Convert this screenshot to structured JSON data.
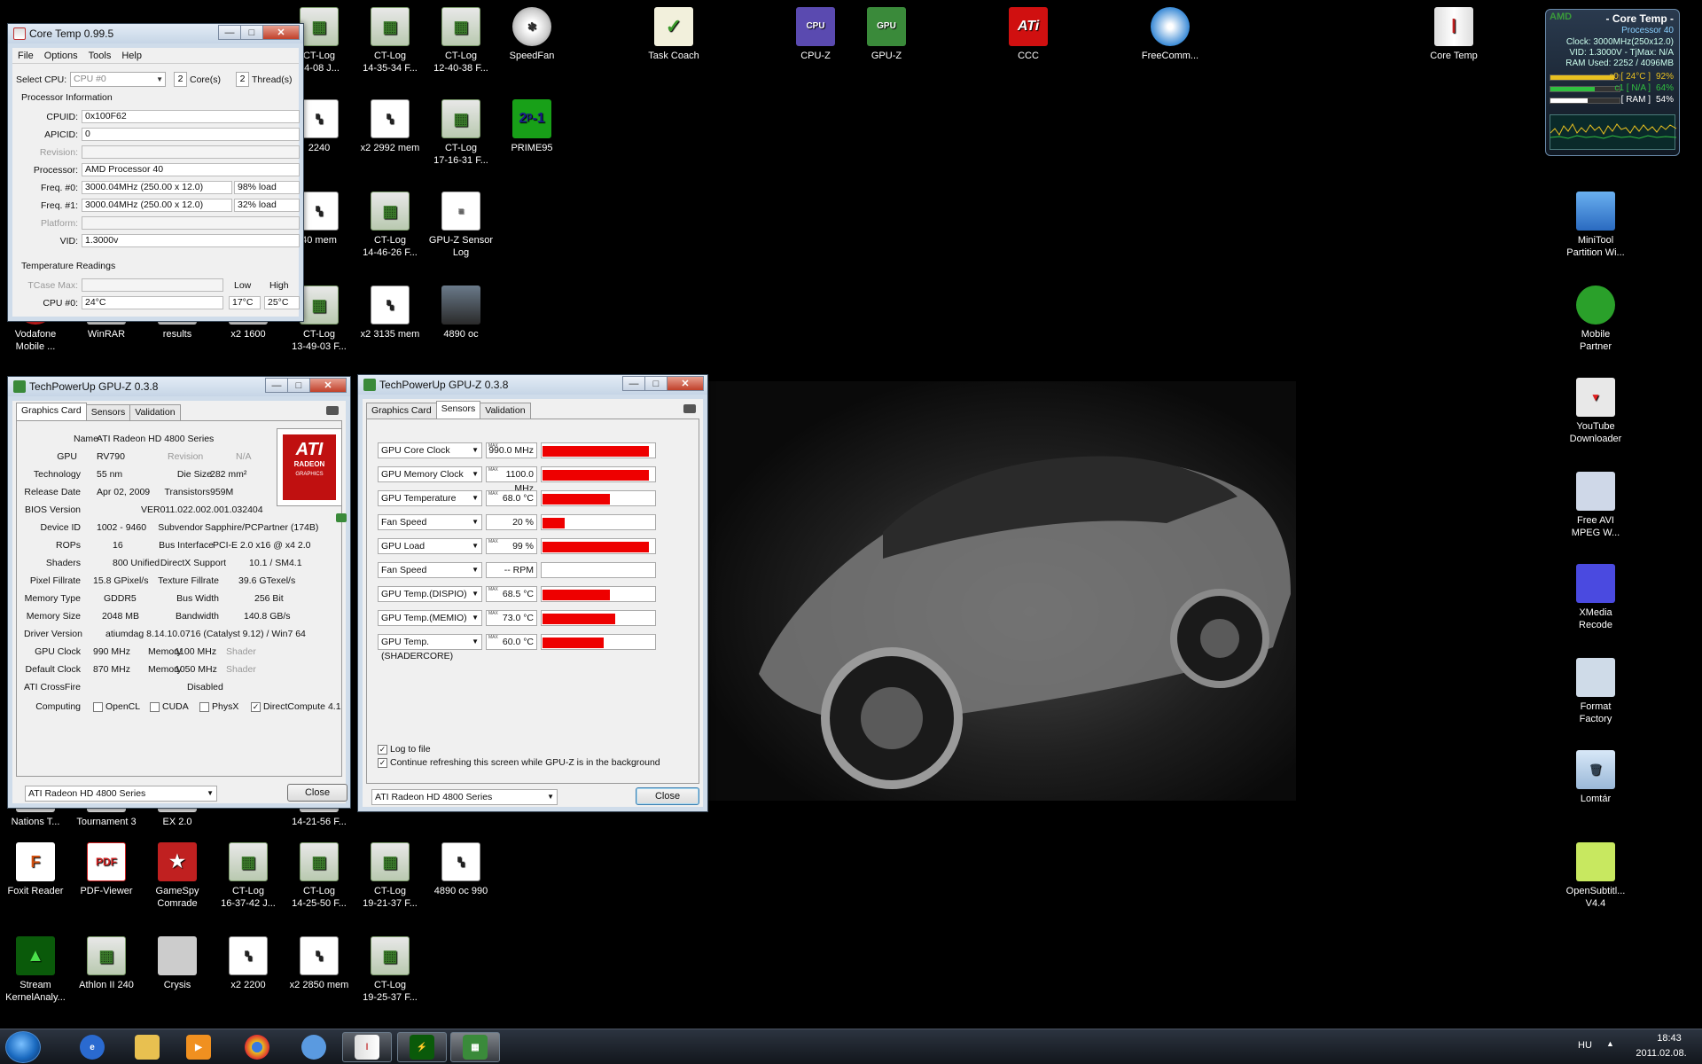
{
  "desktop": {
    "icons": [
      {
        "label": "CT-Log\n14-08 J...",
        "kind": "ctlog"
      },
      {
        "label": "CT-Log\n14-35-34 F...",
        "kind": "ctlog"
      },
      {
        "label": "CT-Log\n12-40-38 F...",
        "kind": "ctlog"
      },
      {
        "label": "SpeedFan",
        "kind": "speedfan"
      },
      {
        "label": "Task Coach",
        "kind": "taskcoach"
      },
      {
        "label": "CPU-Z",
        "kind": "cpuz"
      },
      {
        "label": "GPU-Z",
        "kind": "gpuz"
      },
      {
        "label": "CCC",
        "kind": "ati"
      },
      {
        "label": "FreeComm...",
        "kind": "free"
      },
      {
        "label": "Core Temp",
        "kind": "coretemp"
      },
      {
        "label": "2240",
        "kind": "mem"
      },
      {
        "label": "x2 2992 mem",
        "kind": "mem"
      },
      {
        "label": "CT-Log\n17-16-31 F...",
        "kind": "ctlog"
      },
      {
        "label": "PRIME95",
        "kind": "prime"
      },
      {
        "label": "40 mem",
        "kind": "mem"
      },
      {
        "label": "CT-Log\n14-46-26 F...",
        "kind": "ctlog"
      },
      {
        "label": "GPU-Z Sensor\nLog",
        "kind": "doc"
      },
      {
        "label": "MiniTool\nPartition Wi...",
        "kind": "minitool"
      },
      {
        "label": "Vodafone\nMobile ...",
        "kind": "vodafone"
      },
      {
        "label": "WinRAR",
        "kind": "blank"
      },
      {
        "label": "results",
        "kind": "blank"
      },
      {
        "label": "x2 1600",
        "kind": "blank"
      },
      {
        "label": "CT-Log\n13-49-03 F...",
        "kind": "ctlog"
      },
      {
        "label": "x2 3135 mem",
        "kind": "mem"
      },
      {
        "label": "4890 oc",
        "kind": "photo"
      },
      {
        "label": "Mobile\nPartner",
        "kind": "mobile"
      },
      {
        "label": "YouTube\nDownloader",
        "kind": "yt"
      },
      {
        "label": "Free AVI\nMPEG W...",
        "kind": "avi"
      },
      {
        "label": "XMedia\nRecode",
        "kind": "xmedia"
      },
      {
        "label": "Format\nFactory",
        "kind": "format"
      },
      {
        "label": "Lomtár",
        "kind": "trash"
      },
      {
        "label": "Nations T...",
        "kind": "blank"
      },
      {
        "label": "Tournament 3",
        "kind": "blank"
      },
      {
        "label": "EX 2.0",
        "kind": "blank"
      },
      {
        "label": "14-21-56 F...",
        "kind": "blank"
      },
      {
        "label": "Foxit Reader",
        "kind": "foxit"
      },
      {
        "label": "PDF-Viewer",
        "kind": "pdf"
      },
      {
        "label": "GameSpy\nComrade",
        "kind": "gamespy"
      },
      {
        "label": "CT-Log\n16-37-42 J...",
        "kind": "ctlog"
      },
      {
        "label": "CT-Log\n14-25-50 F...",
        "kind": "ctlog"
      },
      {
        "label": "CT-Log\n19-21-37 F...",
        "kind": "ctlog"
      },
      {
        "label": "4890 oc 990",
        "kind": "mem"
      },
      {
        "label": "OpenSubtitl...\nV4.4",
        "kind": "opensub"
      },
      {
        "label": "Stream\nKernelAnaly...",
        "kind": "stream"
      },
      {
        "label": "Athlon II 240",
        "kind": "ctlog"
      },
      {
        "label": "Crysis",
        "kind": "crysis"
      },
      {
        "label": "x2 2200",
        "kind": "mem"
      },
      {
        "label": "x2 2850 mem",
        "kind": "mem"
      },
      {
        "label": "CT-Log\n19-25-37 F...",
        "kind": "ctlog"
      }
    ]
  },
  "coretemp": {
    "title": "Core Temp 0.99.5",
    "menu": [
      "File",
      "Options",
      "Tools",
      "Help"
    ],
    "select_cpu_label": "Select CPU:",
    "select_cpu_value": "CPU #0",
    "cores_value": "2",
    "cores_label": "Core(s)",
    "threads_value": "2",
    "threads_label": "Thread(s)",
    "proc_info_label": "Processor Information",
    "cpuid_label": "CPUID:",
    "cpuid": "0x100F62",
    "apicid_label": "APICID:",
    "apicid": "0",
    "revision_label": "Revision:",
    "revision": "",
    "processor_label": "Processor:",
    "processor": "AMD Processor 40",
    "freq0_label": "Freq. #0:",
    "freq0": "3000.04MHz (250.00 x 12.0)",
    "load0": "98% load",
    "freq1_label": "Freq. #1:",
    "freq1": "3000.04MHz (250.00 x 12.0)",
    "load1": "32% load",
    "platform_label": "Platform:",
    "platform": "",
    "vid_label": "VID:",
    "vid": "1.3000v",
    "temp_label": "Temperature Readings",
    "tcase_label": "TCase Max:",
    "tcase": "",
    "low_label": "Low",
    "high_label": "High",
    "cpu0_label": "CPU #0:",
    "cpu0": "24°C",
    "cpu0_low": "17°C",
    "cpu0_high": "25°C"
  },
  "gpuz1": {
    "title": "TechPowerUp GPU-Z 0.3.8",
    "tabs": [
      "Graphics Card",
      "Sensors",
      "Validation"
    ],
    "name_label": "Name",
    "name": "ATI Radeon HD 4800 Series",
    "gpu_label": "GPU",
    "gpu": "RV790",
    "revision_label": "Revision",
    "revision": "N/A",
    "tech_label": "Technology",
    "tech": "55 nm",
    "die_label": "Die Size",
    "die": "282 mm²",
    "release_label": "Release Date",
    "release": "Apr 02, 2009",
    "trans_label": "Transistors",
    "trans": "959M",
    "bios_label": "BIOS Version",
    "bios": "VER011.022.002.001.032404",
    "devid_label": "Device ID",
    "devid": "1002 - 9460",
    "subv_label": "Subvendor",
    "subv": "Sapphire/PCPartner (174B)",
    "rops_label": "ROPs",
    "rops": "16",
    "bus_label": "Bus Interface",
    "bus": "PCI-E 2.0 x16 @ x4 2.0",
    "shaders_label": "Shaders",
    "shaders": "800 Unified",
    "dx_label": "DirectX Support",
    "dx": "10.1 / SM4.1",
    "pfill_label": "Pixel Fillrate",
    "pfill": "15.8 GPixel/s",
    "tfill_label": "Texture Fillrate",
    "tfill": "39.6 GTexel/s",
    "memtype_label": "Memory Type",
    "memtype": "GDDR5",
    "busw_label": "Bus Width",
    "busw": "256 Bit",
    "memsize_label": "Memory Size",
    "memsize": "2048 MB",
    "bw_label": "Bandwidth",
    "bw": "140.8 GB/s",
    "driver_label": "Driver Version",
    "driver": "atiumdag 8.14.10.0716 (Catalyst 9.12) / Win7 64",
    "gpuclock_label": "GPU Clock",
    "gpuclock": "990 MHz",
    "mem_label": "Memory",
    "memclock": "1100 MHz",
    "shader_label": "Shader",
    "defclock_label": "Default Clock",
    "defclock": "870 MHz",
    "defmem": "1050 MHz",
    "crossfire_label": "ATI CrossFire",
    "crossfire": "Disabled",
    "computing_label": "Computing",
    "compute": [
      {
        "label": "OpenCL",
        "checked": false
      },
      {
        "label": "CUDA",
        "checked": false
      },
      {
        "label": "PhysX",
        "checked": false
      },
      {
        "label": "DirectCompute 4.1",
        "checked": true
      }
    ],
    "logo_text": "ATI",
    "logo_sub": "RADEON",
    "logo_sub2": "GRAPHICS",
    "card_select": "ATI Radeon HD 4800 Series",
    "close": "Close"
  },
  "gpuz2": {
    "title": "TechPowerUp GPU-Z 0.3.8",
    "tabs": [
      "Graphics Card",
      "Sensors",
      "Validation"
    ],
    "max_tag": "MAX",
    "sensors": [
      {
        "name": "GPU Core Clock",
        "value": "990.0 MHz",
        "max": true,
        "level": 0.95
      },
      {
        "name": "GPU Memory Clock",
        "value": "1100.0 MHz",
        "max": true,
        "level": 0.95
      },
      {
        "name": "GPU Temperature",
        "value": "68.0 °C",
        "max": true,
        "level": 0.6
      },
      {
        "name": "Fan Speed",
        "value": "20 %",
        "max": false,
        "level": 0.2
      },
      {
        "name": "GPU Load",
        "value": "99 %",
        "max": true,
        "level": 0.95
      },
      {
        "name": "Fan Speed",
        "value": "-- RPM",
        "max": false,
        "level": 0
      },
      {
        "name": "GPU Temp.(DISPIO)",
        "value": "68.5 °C",
        "max": true,
        "level": 0.6
      },
      {
        "name": "GPU Temp.(MEMIO)",
        "value": "73.0 °C",
        "max": true,
        "level": 0.65
      },
      {
        "name": "GPU Temp.(SHADERCORE)",
        "value": "60.0 °C",
        "max": true,
        "level": 0.55
      }
    ],
    "log_to_file": "Log to file",
    "continue_refresh": "Continue refreshing this screen while GPU-Z is in the background",
    "card_select": "ATI Radeon HD 4800 Series",
    "close": "Close"
  },
  "gadget": {
    "brand": "AMD",
    "title": "- Core Temp -",
    "processor": "Processor 40",
    "clock": "Clock: 3000MHz(250x12.0)",
    "vid": "VID: 1.3000V - TjMax: N/A",
    "ram": "RAM Used: 2252 / 4096MB",
    "bars": [
      {
        "label": "c0 [ 24°C ]",
        "pct": "92%",
        "level": 0.92,
        "color": "#e8c020"
      },
      {
        "label": "c1 [ N/A ]",
        "pct": "64%",
        "level": 0.64,
        "color": "#30c040"
      },
      {
        "label": "[ RAM ]",
        "pct": "54%",
        "level": 0.54,
        "color": "#ffffff"
      }
    ]
  },
  "taskbar": {
    "lang": "HU",
    "time": "18:43",
    "date": "2011.02.08."
  }
}
